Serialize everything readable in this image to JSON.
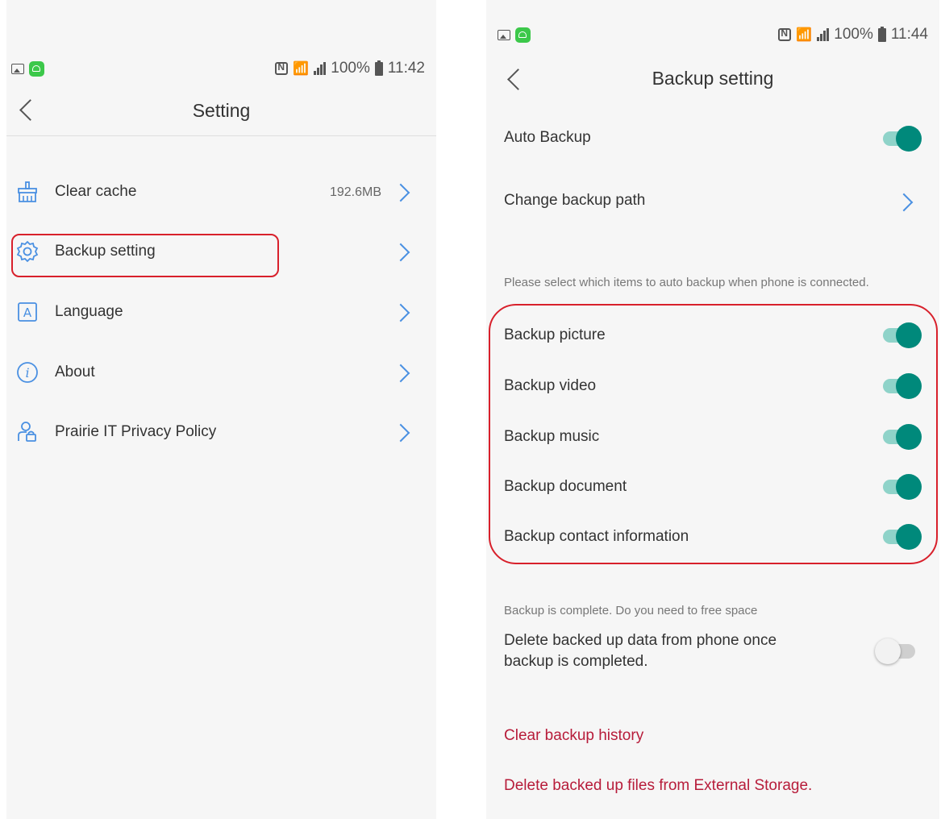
{
  "left_screen": {
    "status_time": "11:42",
    "battery": "100%",
    "title": "Setting",
    "items": [
      {
        "label": "Clear cache",
        "value": "192.6MB",
        "icon": "broom-icon"
      },
      {
        "label": "Backup setting",
        "value": "",
        "icon": "gear-icon"
      },
      {
        "label": "Language",
        "value": "",
        "icon": "language-a-icon"
      },
      {
        "label": "About",
        "value": "",
        "icon": "info-icon"
      },
      {
        "label": "Prairie IT Privacy Policy",
        "value": "",
        "icon": "user-lock-icon"
      }
    ]
  },
  "right_screen": {
    "status_time": "11:44",
    "battery": "100%",
    "title": "Backup setting",
    "auto_backup": {
      "label": "Auto Backup",
      "on": true
    },
    "change_path": {
      "label": "Change backup path"
    },
    "hint": "Please select which items to auto backup when phone is connected.",
    "items": [
      {
        "label": "Backup picture",
        "on": true
      },
      {
        "label": "Backup video",
        "on": true
      },
      {
        "label": "Backup music",
        "on": true
      },
      {
        "label": "Backup document",
        "on": true
      },
      {
        "label": "Backup contact information",
        "on": true
      }
    ],
    "free_space_hint": "Backup is complete. Do you need to free space",
    "delete_after": {
      "label": "Delete backed up data from phone once backup is completed.",
      "on": false
    },
    "clear_history": "Clear backup history",
    "delete_external": "Delete backed up files from External Storage."
  },
  "colors": {
    "accent": "#4a90e2",
    "toggle_on": "#00897b",
    "danger": "#b71c3a",
    "highlight_frame": "#d8202b"
  }
}
